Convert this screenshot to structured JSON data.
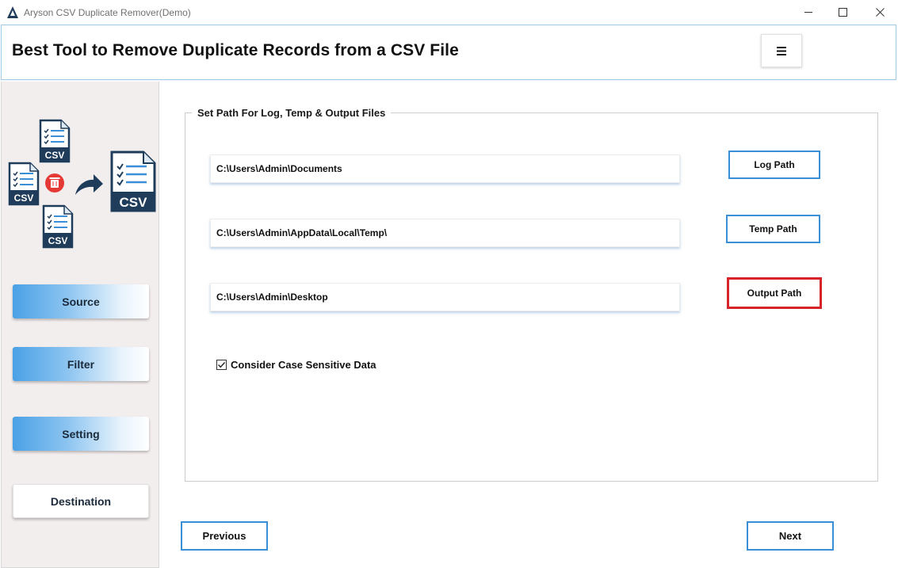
{
  "window": {
    "title": "Aryson CSV Duplicate Remover(Demo)"
  },
  "header": {
    "title": "Best Tool to Remove Duplicate Records from a CSV File",
    "menu_icon": "hamburger-menu-icon"
  },
  "sidebar": {
    "logo_labels": {
      "csv": "CSV"
    },
    "nav": {
      "source": "Source",
      "filter": "Filter",
      "setting": "Setting",
      "destination": "Destination"
    },
    "active_color": "#4aa1e6"
  },
  "main": {
    "group_title": "Set Path For Log, Temp & Output Files",
    "log_path_value": "C:\\Users\\Admin\\Documents",
    "temp_path_value": "C:\\Users\\Admin\\AppData\\Local\\Temp\\",
    "output_path_value": "C:\\Users\\Admin\\Desktop",
    "log_path_button": "Log Path",
    "temp_path_button": "Temp Path",
    "output_path_button": "Output Path",
    "case_sensitive_label": "Consider Case Sensitive Data",
    "case_sensitive_checked": true,
    "highlight_color": "#d7242b",
    "button_border_color": "#3a8fd6"
  },
  "footer": {
    "previous": "Previous",
    "next": "Next"
  }
}
